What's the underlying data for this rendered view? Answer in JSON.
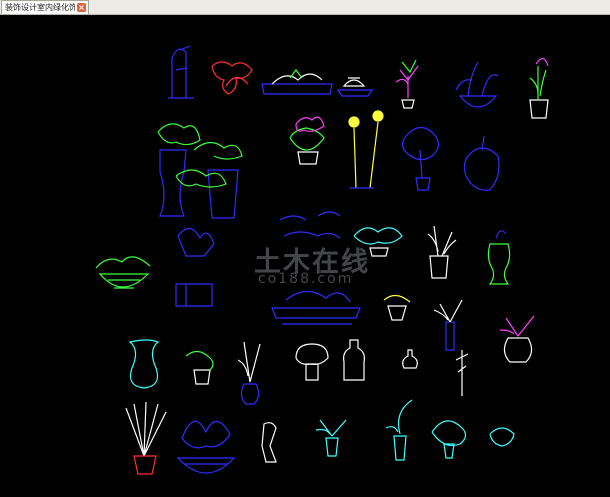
{
  "tab": {
    "title": "装饰设计室内绿化饰一",
    "close_label": "×"
  },
  "watermark": {
    "text": "土木在线",
    "sub": "co188.com"
  },
  "colors": {
    "background": "#000000",
    "blue": "#2d2dff",
    "green": "#3cff3c",
    "white": "#ffffff",
    "cyan": "#40ffff",
    "yellow": "#ffff40",
    "magenta": "#ff40ff",
    "red": "#ff3030"
  }
}
